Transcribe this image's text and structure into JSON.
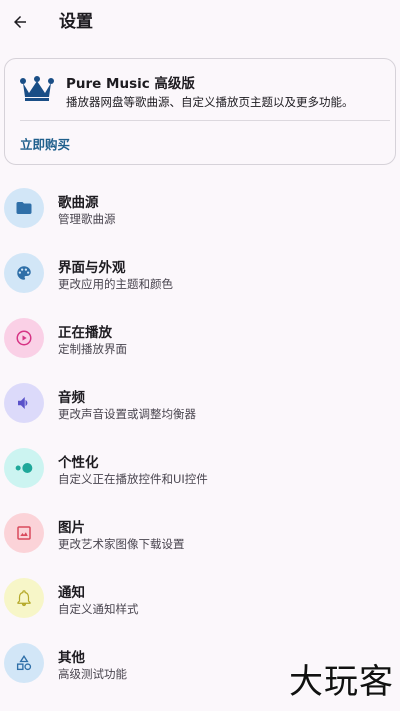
{
  "header": {
    "title": "设置",
    "back_icon": "arrow-back-icon"
  },
  "pro_card": {
    "icon": "crown-icon",
    "icon_color": "#1a4e86",
    "title": "Pure Music 高级版",
    "description": "播放器网盘等歌曲源、自定义播放页主题以及更多功能。",
    "buy_label": "立即购买",
    "buy_color": "#1f5f8c"
  },
  "settings": [
    {
      "title": "歌曲源",
      "subtitle": "管理歌曲源",
      "icon": "folder-icon",
      "bg": "#d2e6f7",
      "fg": "#2f6fa8"
    },
    {
      "title": "界面与外观",
      "subtitle": "更改应用的主题和颜色",
      "icon": "palette-icon",
      "bg": "#d2e6f7",
      "fg": "#2f6fa8"
    },
    {
      "title": "正在播放",
      "subtitle": "定制播放界面",
      "icon": "play-circle-icon",
      "bg": "#fad0e6",
      "fg": "#d63384"
    },
    {
      "title": "音频",
      "subtitle": "更改声音设置或调整均衡器",
      "icon": "volume-icon",
      "bg": "#dcdafa",
      "fg": "#5a52c9"
    },
    {
      "title": "个性化",
      "subtitle": "自定义正在播放控件和UI控件",
      "icon": "toggle-icon",
      "bg": "#ccf4f1",
      "fg": "#1fa89a"
    },
    {
      "title": "图片",
      "subtitle": "更改艺术家图像下载设置",
      "icon": "image-icon",
      "bg": "#fbd3d8",
      "fg": "#d94a5c"
    },
    {
      "title": "通知",
      "subtitle": "自定义通知样式",
      "icon": "bell-icon",
      "bg": "#f7f6c8",
      "fg": "#b5a92a"
    },
    {
      "title": "其他",
      "subtitle": "高级测试功能",
      "icon": "shapes-icon",
      "bg": "#d2e6f7",
      "fg": "#2f6fa8"
    }
  ],
  "watermark": "大玩客"
}
